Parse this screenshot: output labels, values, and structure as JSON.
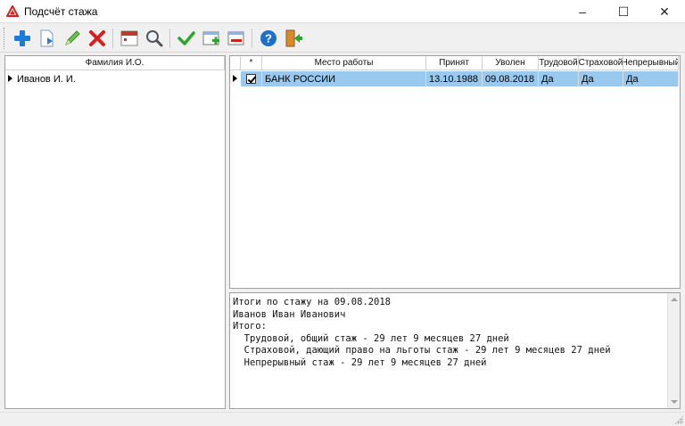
{
  "window": {
    "title": "Подсчёт стажа",
    "minimize": "–",
    "maximize": "☐",
    "close": "✕"
  },
  "toolbar": {
    "buttons": [
      {
        "id": "add",
        "icon": "plus-icon",
        "color": "#1e7bd6"
      },
      {
        "id": "import",
        "icon": "document-arrow-icon",
        "color": "#2a7fd0"
      },
      {
        "id": "edit",
        "icon": "pencil-icon",
        "color": "#3aa83a"
      },
      {
        "id": "delete",
        "icon": "red-x-icon",
        "color": "#d62020"
      },
      {
        "id": "calendar",
        "icon": "calendar-icon",
        "color": "#c0392b"
      },
      {
        "id": "search",
        "icon": "magnifier-icon",
        "color": "#555555"
      },
      {
        "id": "apply",
        "icon": "checkmark-icon",
        "color": "#2fa52f"
      },
      {
        "id": "add-row",
        "icon": "window-plus-icon",
        "color": "#2fa52f"
      },
      {
        "id": "remove-row",
        "icon": "window-minus-icon",
        "color": "#d62020"
      },
      {
        "id": "help",
        "icon": "help-icon",
        "color": "#1e6fc8"
      },
      {
        "id": "exit",
        "icon": "exit-door-icon",
        "color": "#d98a2b"
      }
    ]
  },
  "people": {
    "header": "Фамилия И.О.",
    "rows": [
      {
        "name": "Иванов И. И."
      }
    ]
  },
  "jobs": {
    "headers": {
      "star": "*",
      "place": "Место работы",
      "hired": "Принят",
      "fired": "Уволен",
      "labor": "Трудовой",
      "insurance": "Страховой",
      "continuous": "Непрерывный"
    },
    "rows": [
      {
        "checked": true,
        "place": "БАНК РОССИИ",
        "hired": "13.10.1988",
        "fired": "09.08.2018",
        "labor": "Да",
        "insurance": "Да",
        "continuous": "Да"
      }
    ]
  },
  "summary": {
    "text": "Итоги по стажу на 09.08.2018\nИванов Иван Иванович\nИтого:\n  Трудовой, общий стаж - 29 лет 9 месяцев 27 дней\n  Страховой, дающий право на льготы стаж - 29 лет 9 месяцев 27 дней\n  Непрерывный стаж - 29 лет 9 месяцев 27 дней"
  },
  "colors": {
    "selection": "#99c9ef",
    "accent": "#1e7bd6"
  }
}
